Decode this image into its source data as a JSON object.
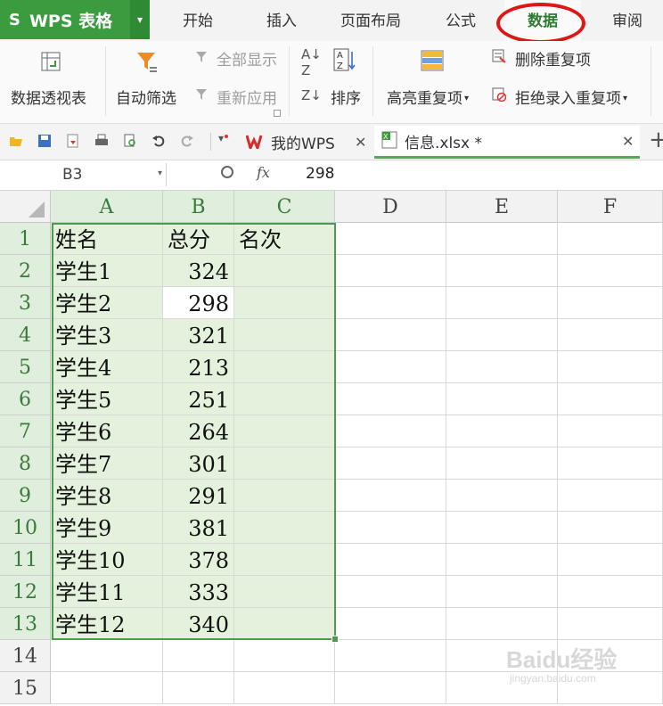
{
  "app": {
    "wps_label": "WPS 表格"
  },
  "menu": {
    "tabs": [
      {
        "label": "开始"
      },
      {
        "label": "插入"
      },
      {
        "label": "页面布局"
      },
      {
        "label": "公式"
      },
      {
        "label": "数据",
        "active": true
      },
      {
        "label": "审阅"
      }
    ]
  },
  "ribbon": {
    "pivot": "数据透视表",
    "autofilter": "自动筛选",
    "show_all": "全部显示",
    "reapply": "重新应用",
    "sort": "排序",
    "highlight_dup": "高亮重复项",
    "remove_dup": "删除重复项",
    "reject_dup": "拒绝录入重复项"
  },
  "doc_tabs": [
    {
      "label": "我的WPS"
    },
    {
      "label": "信息.xlsx *",
      "active": true
    }
  ],
  "formula_bar": {
    "cell_ref": "B3",
    "fx": "fx",
    "value": "298"
  },
  "sheet": {
    "columns": [
      "A",
      "B",
      "C",
      "D",
      "E",
      "F"
    ],
    "rows": [
      "1",
      "2",
      "3",
      "4",
      "5",
      "6",
      "7",
      "8",
      "9",
      "10",
      "11",
      "12",
      "13",
      "14",
      "15"
    ],
    "data": [
      [
        "姓名",
        "总分",
        "名次"
      ],
      [
        "学生1",
        "324",
        ""
      ],
      [
        "学生2",
        "298",
        ""
      ],
      [
        "学生3",
        "321",
        ""
      ],
      [
        "学生4",
        "213",
        ""
      ],
      [
        "学生5",
        "251",
        ""
      ],
      [
        "学生6",
        "264",
        ""
      ],
      [
        "学生7",
        "301",
        ""
      ],
      [
        "学生8",
        "291",
        ""
      ],
      [
        "学生9",
        "381",
        ""
      ],
      [
        "学生10",
        "378",
        ""
      ],
      [
        "学生11",
        "333",
        ""
      ],
      [
        "学生12",
        "340",
        ""
      ]
    ]
  },
  "watermark": {
    "brand": "Baidu经验",
    "url": "jingyan.baidu.com"
  },
  "colors": {
    "accent": "#3b9b3f",
    "selection": "#e4f2dd",
    "highlight_circle": "#e01515"
  }
}
